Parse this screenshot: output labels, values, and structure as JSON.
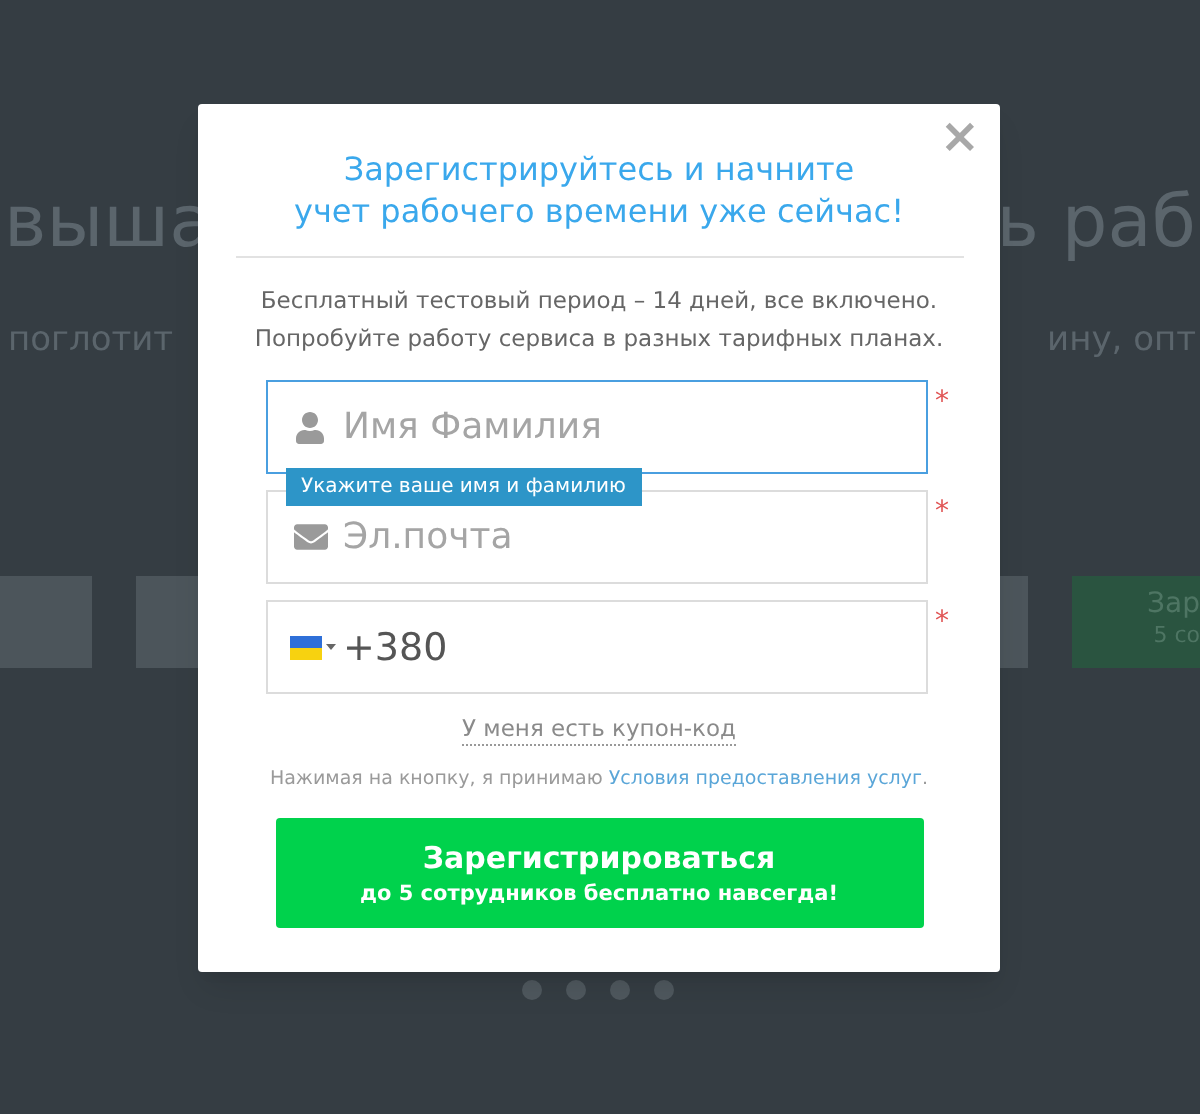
{
  "background": {
    "headline_left": "выша",
    "headline_right": "ь раб",
    "subline_left": "поглотит",
    "subline_right": "ину, опт",
    "cta_title": "Зар",
    "cta_subtitle": "5 со",
    "dots": [
      {
        "kind": "dot"
      },
      {
        "kind": "dot"
      },
      {
        "kind": "dot"
      },
      {
        "kind": "dot"
      }
    ]
  },
  "modal": {
    "close": "×",
    "title_lines": [
      "Зарегистрируйтесь и начните",
      "учет рабочего времени уже сейчас!"
    ],
    "intro_lines": [
      "Бесплатный тестовый период – 14 дней, все включено.",
      "Попробуйте работу сервиса в разных тарифных планах."
    ],
    "fields": [
      {
        "kind": "name",
        "placeholder": "Имя Фамилия",
        "focused": true,
        "required": "*",
        "tooltip": "Укажите ваше имя и фамилию"
      },
      {
        "kind": "email",
        "placeholder": "Эл.почта",
        "focused": false,
        "required": "*"
      },
      {
        "kind": "phone",
        "value": "+380",
        "focused": false,
        "required": "*"
      }
    ],
    "coupon_link": "У меня есть купон-код",
    "terms_text": "Нажимая на кнопку, я принимаю",
    "terms_link": "Условия предоставления услуг",
    "terms_end": ".",
    "submit": {
      "title": "Зарегистрироваться",
      "subtitle": "до 5 сотрудников бесплатно навсегда!"
    }
  }
}
